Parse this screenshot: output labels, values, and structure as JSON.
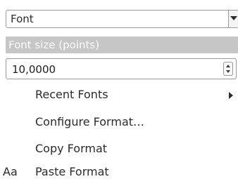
{
  "font_select": {
    "value": "Font"
  },
  "section": {
    "title": "Font size (points)"
  },
  "font_size": {
    "value": "10,0000"
  },
  "menu": {
    "items": [
      {
        "label": "Recent Fonts",
        "has_submenu": true
      },
      {
        "label": "Configure Format…"
      },
      {
        "label": "Copy Format"
      },
      {
        "label": "Paste Format",
        "icon_text": "Aa"
      }
    ]
  },
  "colors": {
    "section_header_bg": "#c6c6c6",
    "border": "#9a9a9a"
  }
}
